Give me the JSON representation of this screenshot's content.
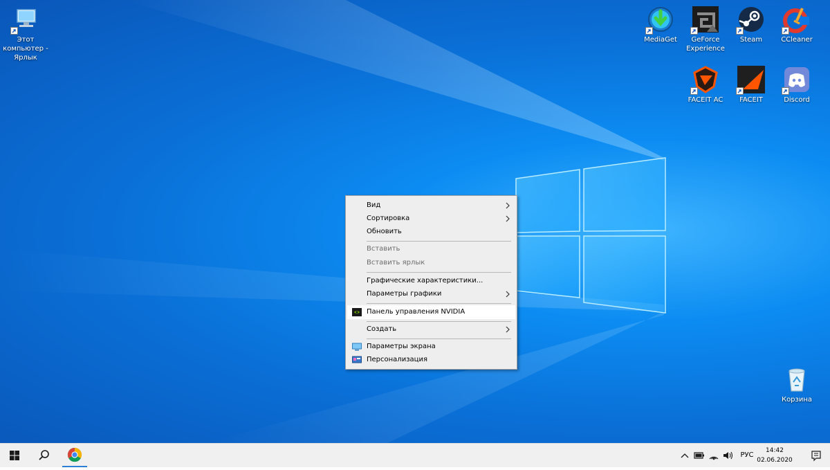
{
  "desktop": {
    "icons_left": [
      {
        "name": "this-pc-icon",
        "label": "Этот компьютер - Ярлык"
      }
    ],
    "icons_right_row1": [
      {
        "name": "mediaget-icon",
        "label": "MediaGet"
      },
      {
        "name": "geforce-experience-icon",
        "label": "GeForce Experience"
      },
      {
        "name": "steam-icon",
        "label": "Steam"
      },
      {
        "name": "ccleaner-icon",
        "label": "CCleaner"
      }
    ],
    "icons_right_row2": [
      {
        "name": "faceit-ac-icon",
        "label": "FACEIT AC"
      },
      {
        "name": "faceit-icon",
        "label": "FACEIT"
      },
      {
        "name": "discord-icon",
        "label": "Discord"
      }
    ],
    "recycle_bin": {
      "name": "recycle-bin-icon",
      "label": "Корзина"
    }
  },
  "context_menu": {
    "view": "Вид",
    "sort": "Сортировка",
    "refresh": "Обновить",
    "paste": "Вставить",
    "paste_shortcut": "Вставить ярлык",
    "graphics_properties": "Графические характеристики...",
    "graphics_options": "Параметры графики",
    "nvidia_panel": "Панель управления NVIDIA",
    "new": "Создать",
    "display_settings": "Параметры экрана",
    "personalize": "Персонализация"
  },
  "taskbar": {
    "start_icon": "windows-logo",
    "search_icon": "search-icon",
    "pinned": [
      "chrome-icon"
    ],
    "tray": {
      "language": "РУС",
      "time": "14:42",
      "date": "02.06.2020"
    }
  },
  "colors": {
    "desktop_blue": "#0a78e6",
    "menu_bg": "#eeeeee",
    "taskbar_bg": "#f0f0f0"
  }
}
